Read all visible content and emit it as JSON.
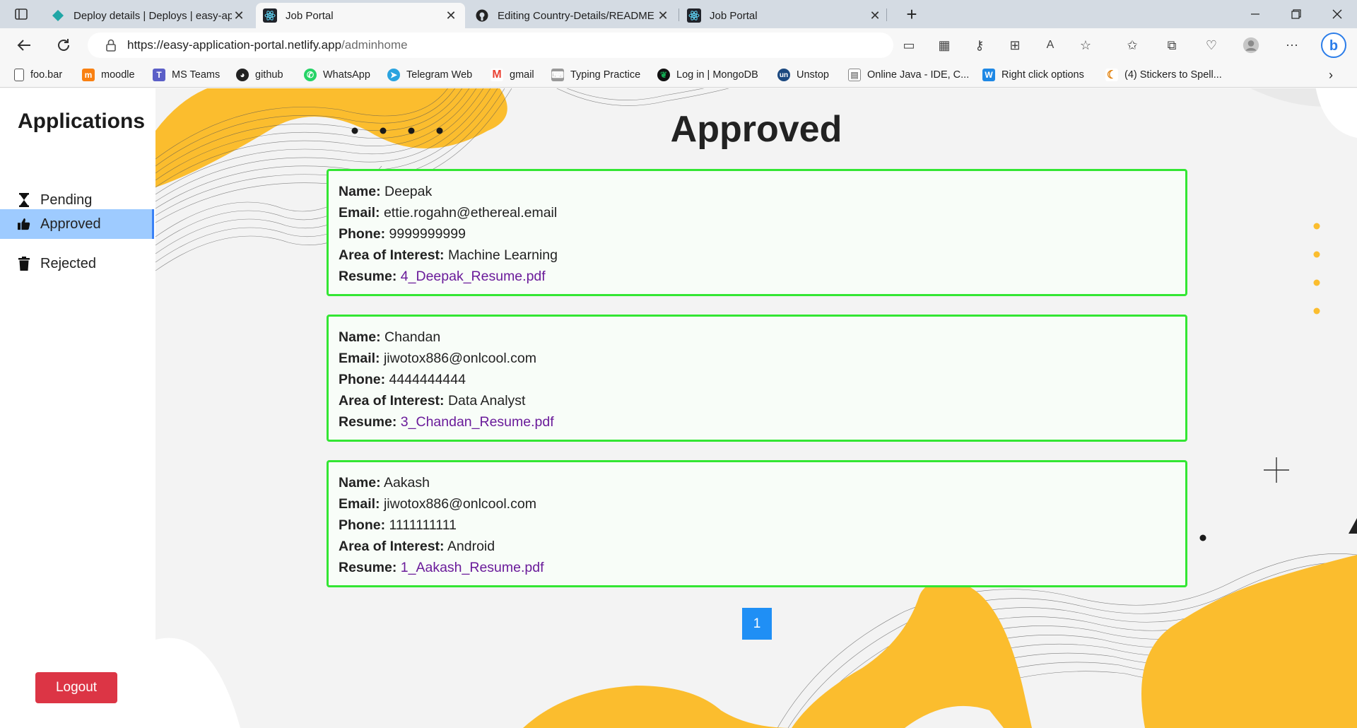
{
  "browser": {
    "tabs": [
      {
        "title": "Deploy details | Deploys | easy-ap",
        "icon": "netlify-icon"
      },
      {
        "title": "Job Portal",
        "icon": "react-icon",
        "active": true
      },
      {
        "title": "Editing Country-Details/README",
        "icon": "github-icon"
      },
      {
        "title": "Job Portal",
        "icon": "react-icon"
      }
    ],
    "new_tab": "+",
    "url_host": "https://easy-application-portal.netlify.app",
    "url_path": "/adminhome",
    "bookmarks": [
      {
        "label": "foo.bar",
        "icon": "page-icon",
        "color": "#555555"
      },
      {
        "label": "moodle",
        "icon": "moodle-icon",
        "color": "#f98012"
      },
      {
        "label": "MS Teams",
        "icon": "teams-icon",
        "color": "#5b5fc7"
      },
      {
        "label": "github",
        "icon": "github-icon",
        "color": "#222222"
      },
      {
        "label": "WhatsApp",
        "icon": "whatsapp-icon",
        "color": "#25d366"
      },
      {
        "label": "Telegram Web",
        "icon": "telegram-icon",
        "color": "#2aa3df"
      },
      {
        "label": "gmail",
        "icon": "gmail-icon",
        "color": "#ea4335"
      },
      {
        "label": "Typing Practice",
        "icon": "typing-icon",
        "color": "#777777"
      },
      {
        "label": "Log in | MongoDB",
        "icon": "mongodb-icon",
        "color": "#13aa52"
      },
      {
        "label": "Unstop",
        "icon": "unstop-icon",
        "color": "#1c4980"
      },
      {
        "label": "Online Java - IDE, C...",
        "icon": "ide-icon",
        "color": "#888888"
      },
      {
        "label": "Right click options",
        "icon": "w-icon",
        "color": "#1e88e5"
      },
      {
        "label": "(4) Stickers to Spell...",
        "icon": "stickers-icon",
        "color": "#e07b00"
      }
    ]
  },
  "sidebar": {
    "title": "Applications",
    "items": [
      {
        "label": "Pending",
        "icon": "hourglass-icon"
      },
      {
        "label": "Approved",
        "icon": "thumbs-up-icon",
        "active": true
      },
      {
        "label": "Rejected",
        "icon": "trash-icon"
      }
    ],
    "logout": "Logout"
  },
  "main": {
    "title": "Approved",
    "field_labels": {
      "name": "Name:",
      "email": "Email:",
      "phone": "Phone:",
      "interest": "Area of Interest:",
      "resume": "Resume:"
    },
    "applications": [
      {
        "name": "Deepak",
        "email": "ettie.rogahn@ethereal.email",
        "phone": "9999999999",
        "interest": "Machine Learning",
        "resume": "4_Deepak_Resume.pdf"
      },
      {
        "name": "Chandan",
        "email": "jiwotox886@onlcool.com",
        "phone": "4444444444",
        "interest": "Data Analyst",
        "resume": "3_Chandan_Resume.pdf"
      },
      {
        "name": "Aakash",
        "email": "jiwotox886@onlcool.com",
        "phone": "1111111111",
        "interest": "Android",
        "resume": "1_Aakash_Resume.pdf"
      }
    ],
    "page": "1"
  },
  "colors": {
    "accent": "#1f8ff5",
    "approved_border": "#33e633",
    "logout": "#dc3545",
    "sidebar_active": "#9ecbff",
    "decor": "#fbbd2e"
  }
}
